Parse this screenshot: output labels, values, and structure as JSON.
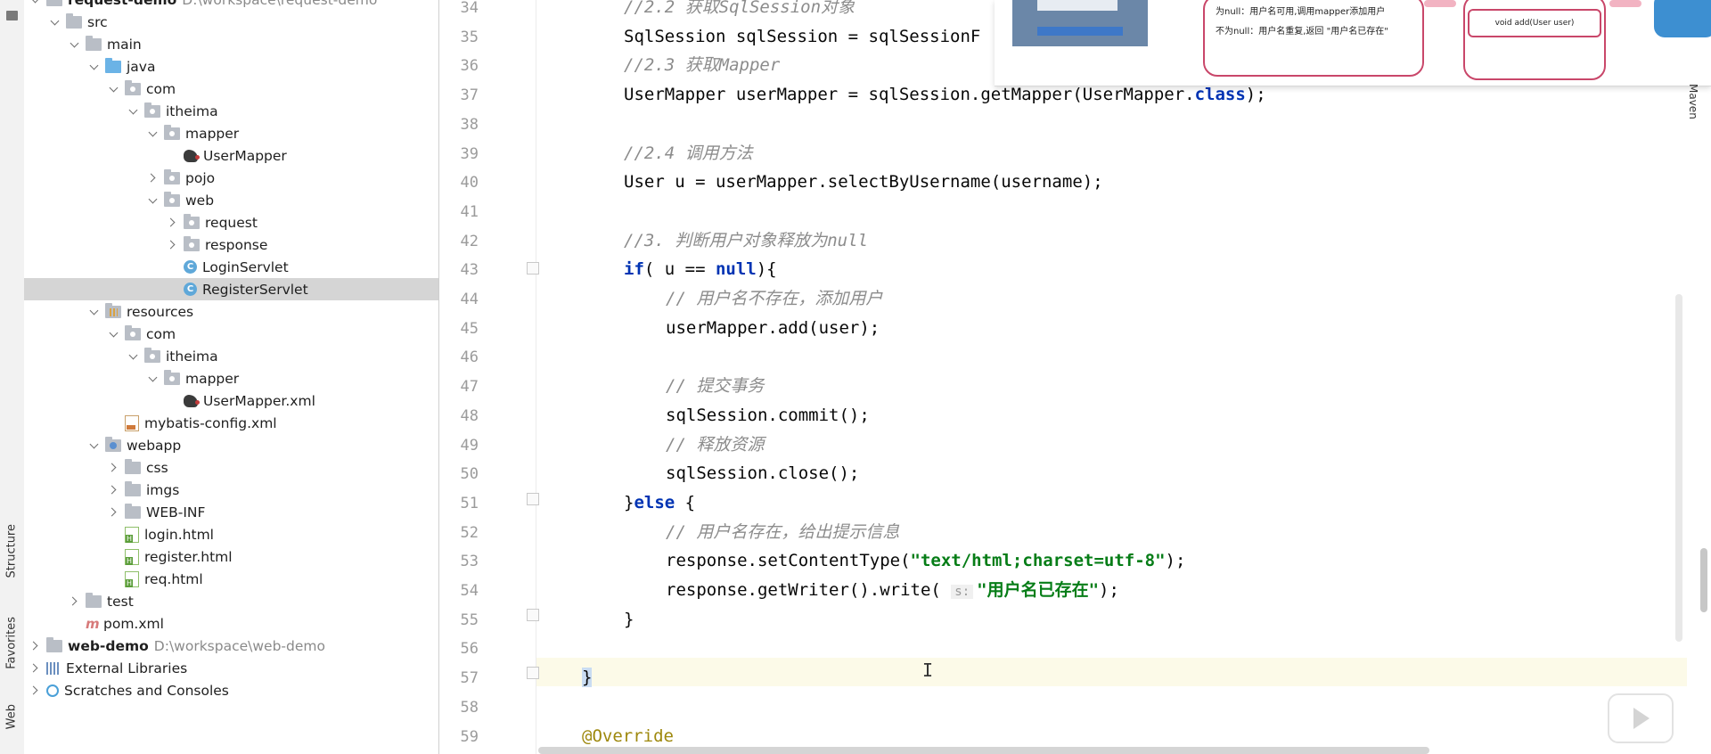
{
  "left_strip": {
    "tabs": [
      "Structure",
      "Favorites",
      "Web"
    ]
  },
  "project_tree": [
    {
      "indent": 0,
      "chev": "down",
      "icon": "folder-module",
      "label": "request-demo",
      "extra": "D:\\workspace\\request-demo",
      "bold": true
    },
    {
      "indent": 1,
      "chev": "down",
      "icon": "folder",
      "label": "src"
    },
    {
      "indent": 2,
      "chev": "down",
      "icon": "folder",
      "label": "main"
    },
    {
      "indent": 3,
      "chev": "down",
      "icon": "folder-blue",
      "label": "java"
    },
    {
      "indent": 4,
      "chev": "down",
      "icon": "package",
      "label": "com"
    },
    {
      "indent": 5,
      "chev": "down",
      "icon": "package",
      "label": "itheima"
    },
    {
      "indent": 6,
      "chev": "down",
      "icon": "package",
      "label": "mapper"
    },
    {
      "indent": 7,
      "chev": "none",
      "icon": "mybatis",
      "label": "UserMapper"
    },
    {
      "indent": 6,
      "chev": "right",
      "icon": "package",
      "label": "pojo"
    },
    {
      "indent": 6,
      "chev": "down",
      "icon": "package",
      "label": "web"
    },
    {
      "indent": 7,
      "chev": "right",
      "icon": "package",
      "label": "request"
    },
    {
      "indent": 7,
      "chev": "right",
      "icon": "package",
      "label": "response"
    },
    {
      "indent": 7,
      "chev": "none",
      "icon": "class",
      "label": "LoginServlet"
    },
    {
      "indent": 7,
      "chev": "none",
      "icon": "class",
      "label": "RegisterServlet",
      "selected": true
    },
    {
      "indent": 3,
      "chev": "down",
      "icon": "folder-resources",
      "label": "resources"
    },
    {
      "indent": 4,
      "chev": "down",
      "icon": "package",
      "label": "com"
    },
    {
      "indent": 5,
      "chev": "down",
      "icon": "package",
      "label": "itheima"
    },
    {
      "indent": 6,
      "chev": "down",
      "icon": "package",
      "label": "mapper"
    },
    {
      "indent": 7,
      "chev": "none",
      "icon": "mybatis",
      "label": "UserMapper.xml"
    },
    {
      "indent": 4,
      "chev": "none",
      "icon": "xml",
      "label": "mybatis-config.xml"
    },
    {
      "indent": 3,
      "chev": "down",
      "icon": "folder-web",
      "label": "webapp"
    },
    {
      "indent": 4,
      "chev": "right",
      "icon": "folder",
      "label": "css"
    },
    {
      "indent": 4,
      "chev": "right",
      "icon": "folder",
      "label": "imgs"
    },
    {
      "indent": 4,
      "chev": "right",
      "icon": "folder",
      "label": "WEB-INF"
    },
    {
      "indent": 4,
      "chev": "none",
      "icon": "html",
      "label": "login.html"
    },
    {
      "indent": 4,
      "chev": "none",
      "icon": "html",
      "label": "register.html"
    },
    {
      "indent": 4,
      "chev": "none",
      "icon": "html",
      "label": "req.html"
    },
    {
      "indent": 2,
      "chev": "right",
      "icon": "folder",
      "label": "test"
    },
    {
      "indent": 2,
      "chev": "none",
      "icon": "maven",
      "label": "pom.xml"
    },
    {
      "indent": 0,
      "chev": "right",
      "icon": "folder-module",
      "label": "web-demo",
      "extra": "D:\\workspace\\web-demo",
      "bold": true
    },
    {
      "indent": 0,
      "chev": "right",
      "icon": "libraries",
      "label": "External Libraries"
    },
    {
      "indent": 0,
      "chev": "right",
      "icon": "scratches",
      "label": "Scratches and Consoles"
    }
  ],
  "editor": {
    "lines": [
      {
        "n": "34",
        "indent": 1,
        "parts": [
          [
            "cmt",
            "//2.2 获取SqlSession对象"
          ]
        ]
      },
      {
        "n": "35",
        "indent": 1,
        "parts": [
          [
            "txt",
            "SqlSession sqlSession = sqlSessionF"
          ]
        ]
      },
      {
        "n": "36",
        "indent": 1,
        "parts": [
          [
            "cmt",
            "//2.3 获取Mapper"
          ]
        ]
      },
      {
        "n": "37",
        "indent": 1,
        "parts": [
          [
            "txt",
            "UserMapper userMapper = sqlSession.getMapper(UserMapper."
          ],
          [
            "kw",
            "class"
          ],
          [
            "txt",
            ");"
          ]
        ]
      },
      {
        "n": "38",
        "indent": 1,
        "parts": []
      },
      {
        "n": "39",
        "indent": 1,
        "parts": [
          [
            "cmt",
            "//2.4 调用方法"
          ]
        ]
      },
      {
        "n": "40",
        "indent": 1,
        "parts": [
          [
            "txt",
            "User u = userMapper.selectByUsername(username);"
          ]
        ]
      },
      {
        "n": "41",
        "indent": 1,
        "parts": []
      },
      {
        "n": "42",
        "indent": 1,
        "parts": [
          [
            "cmt",
            "//3. 判断用户对象释放为null"
          ]
        ]
      },
      {
        "n": "43",
        "indent": 1,
        "parts": [
          [
            "kw",
            "if"
          ],
          [
            "txt",
            "( u == "
          ],
          [
            "kw",
            "null"
          ],
          [
            "txt",
            "){"
          ]
        ]
      },
      {
        "n": "44",
        "indent": 2,
        "parts": [
          [
            "cmt",
            "// 用户名不存在，添加用户"
          ]
        ]
      },
      {
        "n": "45",
        "indent": 2,
        "parts": [
          [
            "txt",
            "userMapper.add(user);"
          ]
        ]
      },
      {
        "n": "46",
        "indent": 2,
        "parts": []
      },
      {
        "n": "47",
        "indent": 2,
        "parts": [
          [
            "cmt",
            "// 提交事务"
          ]
        ]
      },
      {
        "n": "48",
        "indent": 2,
        "parts": [
          [
            "txt",
            "sqlSession.commit();"
          ]
        ]
      },
      {
        "n": "49",
        "indent": 2,
        "parts": [
          [
            "cmt",
            "// 释放资源"
          ]
        ]
      },
      {
        "n": "50",
        "indent": 2,
        "parts": [
          [
            "txt",
            "sqlSession.close();"
          ]
        ]
      },
      {
        "n": "51",
        "indent": 1,
        "parts": [
          [
            "txt",
            "}"
          ],
          [
            "kw",
            "else"
          ],
          [
            "txt",
            " {"
          ]
        ]
      },
      {
        "n": "52",
        "indent": 2,
        "parts": [
          [
            "cmt",
            "// 用户名存在，给出提示信息"
          ]
        ]
      },
      {
        "n": "53",
        "indent": 2,
        "parts": [
          [
            "txt",
            "response.setContentType("
          ],
          [
            "str",
            "\"text/html;charset=utf-8\""
          ],
          [
            "txt",
            ");"
          ]
        ]
      },
      {
        "n": "54",
        "indent": 2,
        "parts": [
          [
            "txt",
            "response.getWriter().write( "
          ],
          [
            "hint",
            "s:"
          ],
          [
            "str",
            "\"用户名已存在\""
          ],
          [
            "txt",
            ");"
          ]
        ]
      },
      {
        "n": "55",
        "indent": 1,
        "parts": [
          [
            "txt",
            "}"
          ]
        ]
      },
      {
        "n": "56",
        "indent": 0,
        "parts": []
      },
      {
        "n": "57",
        "indent": 0,
        "parts": [
          [
            "brace",
            "}"
          ]
        ]
      },
      {
        "n": "58",
        "indent": 0,
        "parts": []
      },
      {
        "n": "59",
        "indent": 0,
        "parts": [
          [
            "ann",
            "@Override"
          ]
        ]
      }
    ]
  },
  "overlay_popup": {
    "item1": "为null：用户名可用,调用mapper添加用户",
    "item2": "不为null：用户名重复,返回 \"用户名已存在\"",
    "method_box": "void add(User user)"
  },
  "right_strip": {
    "label": "Maven"
  }
}
